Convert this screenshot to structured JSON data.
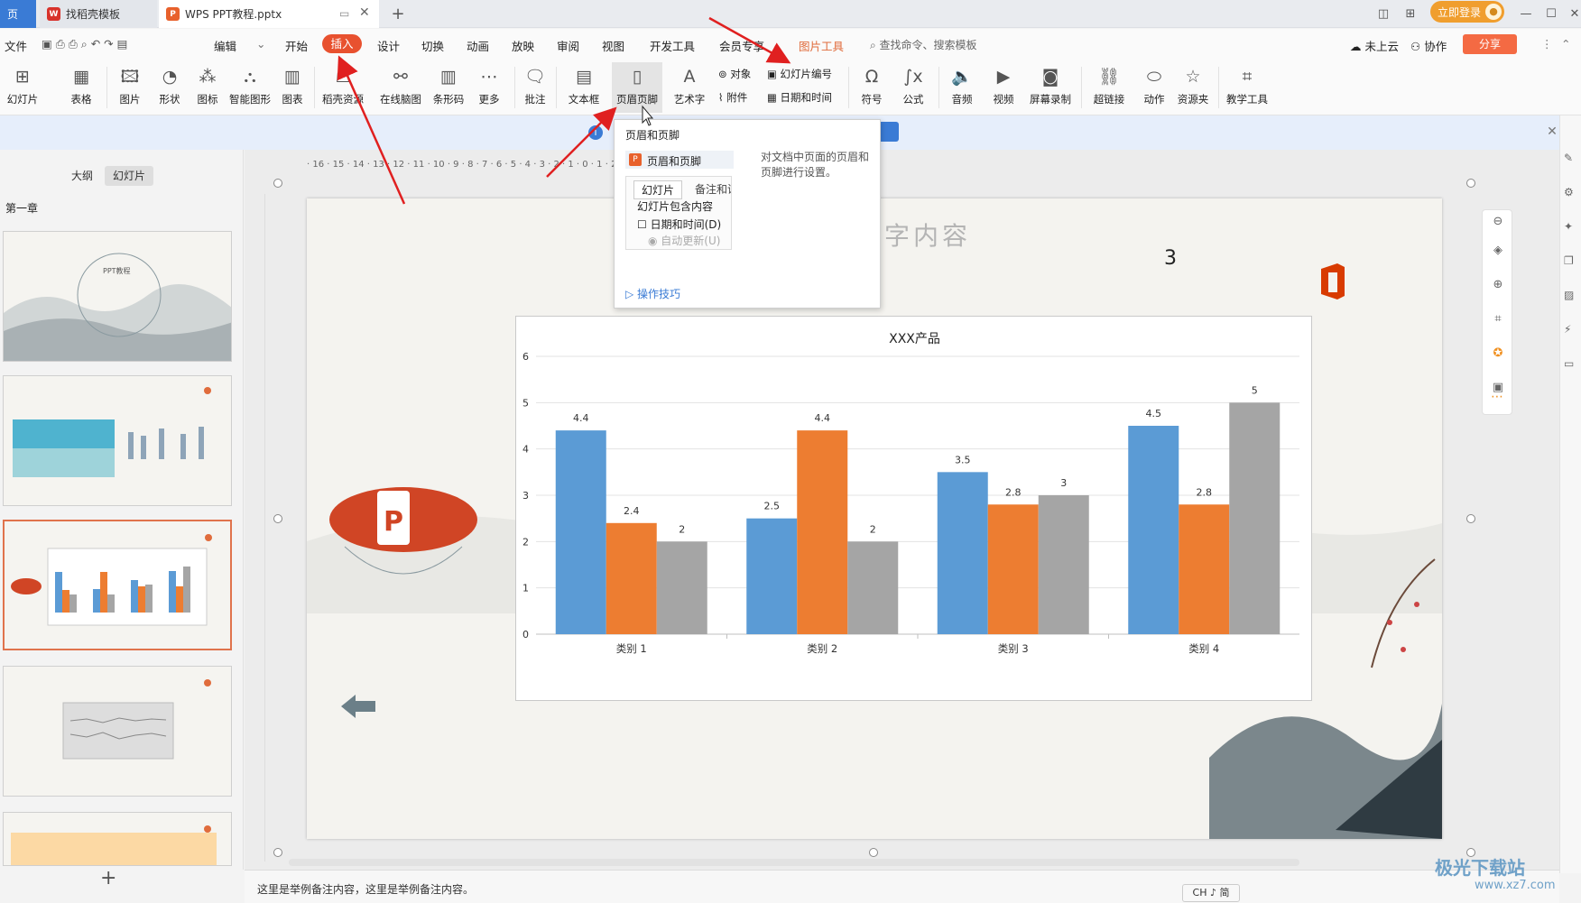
{
  "titlebar": {
    "tabs": [
      {
        "label": "页",
        "name": "home"
      },
      {
        "label": "找稻壳模板",
        "name": "templates"
      },
      {
        "label": "WPS PPT教程.pptx",
        "name": "document"
      }
    ],
    "login": "立即登录"
  },
  "menubar": {
    "items": [
      "文件",
      "编辑",
      "开始",
      "插入",
      "设计",
      "切换",
      "动画",
      "放映",
      "审阅",
      "视图",
      "开发工具",
      "会员专享",
      "图片工具"
    ],
    "search": "查找命令、搜索模板",
    "cloud": "未上云",
    "collab": "协作",
    "share": "分享"
  },
  "ribbon": {
    "items": [
      "幻灯片",
      "表格",
      "图片",
      "形状",
      "图标",
      "智能图形",
      "图表",
      "稻壳资源",
      "在线脑图",
      "条形码",
      "更多",
      "批注",
      "文本框",
      "页眉页脚",
      "艺术字",
      "符号",
      "公式",
      "音频",
      "视频",
      "屏幕录制",
      "超链接",
      "动作",
      "资源夹",
      "教学工具"
    ],
    "small": [
      "对象",
      "附件",
      "幻灯片编号",
      "日期和时间"
    ]
  },
  "popup": {
    "title": "页眉和页脚",
    "item_label": "页眉和页脚",
    "desc1": "对文档中页面的页眉和",
    "desc2": "页脚进行设置。",
    "tab_slide": "幻灯片",
    "tab_notes": "备注和讲",
    "group": "幻灯片包含内容",
    "datetime": "日期和时间(D)",
    "autoupdate": "自动更新(U)",
    "tips": "操作技巧"
  },
  "leftpanel": {
    "tab_outline": "大纲",
    "tab_slides": "幻灯片",
    "chapter": "第一章",
    "thumb1_title": "PPT教程"
  },
  "slide": {
    "title": "文字内容",
    "number": "3"
  },
  "notes": {
    "text": "这里是举例备注内容，这里是举例备注内容。"
  },
  "status": {
    "ime": "CH ♪ 简"
  },
  "watermark": {
    "main": "极光下载站",
    "sub": "www.xz7.com"
  },
  "colors": {
    "accent": "#e8512f",
    "series1": "#5b9bd5",
    "series2": "#ed7d31",
    "series3": "#a5a5a5"
  },
  "chart_data": {
    "type": "bar",
    "title": "XXX产品",
    "categories": [
      "类别 1",
      "类别 2",
      "类别 3",
      "类别 4"
    ],
    "series": [
      {
        "values": [
          4.4,
          2.5,
          3.5,
          4.5
        ]
      },
      {
        "values": [
          2.4,
          4.4,
          2.8,
          2.8
        ]
      },
      {
        "values": [
          2,
          2,
          3,
          5
        ]
      }
    ],
    "yticks": [
      "0",
      "1",
      "2",
      "3",
      "4",
      "5",
      "6"
    ],
    "ylim": [
      0,
      6
    ],
    "grid": true,
    "legend": "none"
  }
}
